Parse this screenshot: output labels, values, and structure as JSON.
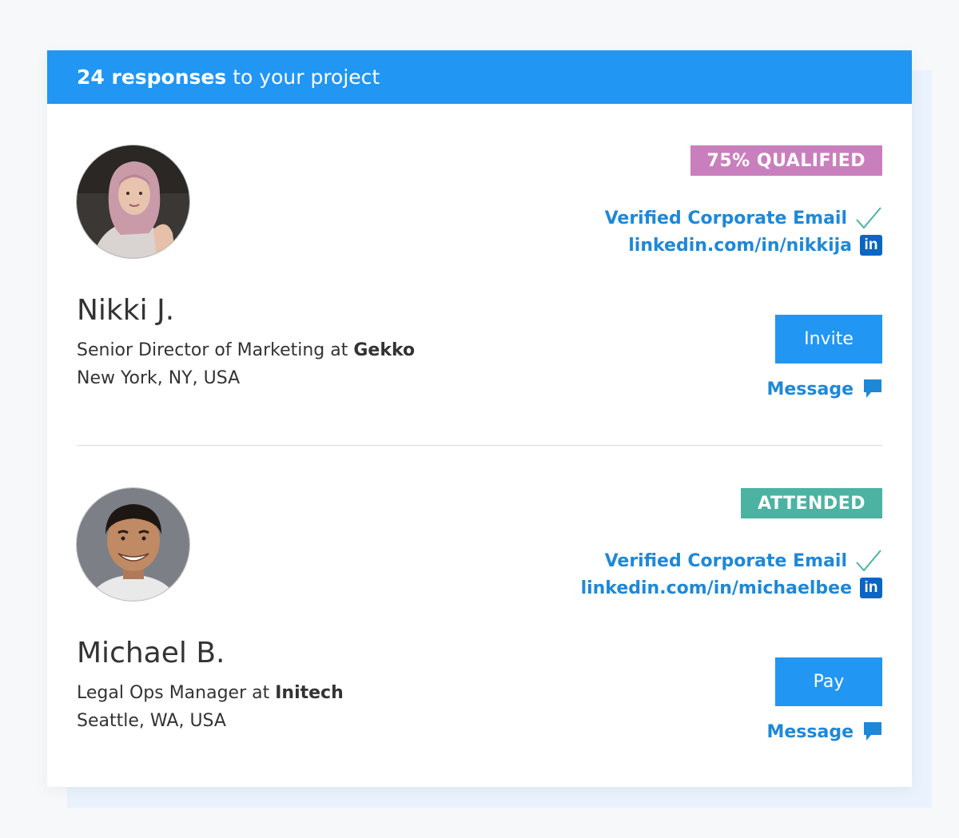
{
  "header": {
    "count_label": "24 responses",
    "rest_label": "to your project"
  },
  "colors": {
    "primary": "#2196f3",
    "link": "#1e88d8",
    "badge_qualified": "#c97fbd",
    "badge_attended": "#4cb3a2",
    "linkedin": "#0a66c2"
  },
  "responses": [
    {
      "name": "Nikki J.",
      "role": "Senior Director of Marketing at",
      "company": "Gekko",
      "location": "New York, NY, USA",
      "badge": "75% QUALIFIED",
      "verified_label": "Verified Corporate Email",
      "linkedin": "linkedin.com/in/nikkija",
      "linkedin_icon_text": "in",
      "action_label": "Invite",
      "message_label": "Message"
    },
    {
      "name": "Michael B.",
      "role": "Legal Ops Manager at",
      "company": "Initech",
      "location": "Seattle, WA, USA",
      "badge": "ATTENDED",
      "verified_label": "Verified Corporate Email",
      "linkedin": "linkedin.com/in/michaelbee",
      "linkedin_icon_text": "in",
      "action_label": "Pay",
      "message_label": "Message"
    }
  ]
}
